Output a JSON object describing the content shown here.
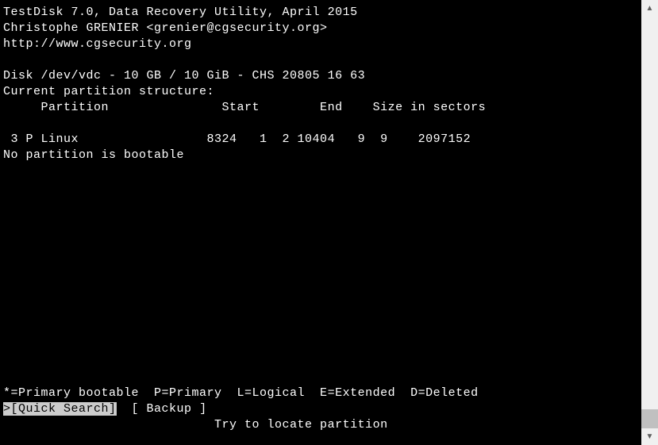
{
  "header": {
    "line1": "TestDisk 7.0, Data Recovery Utility, April 2015",
    "line2": "Christophe GRENIER <grenier@cgsecurity.org>",
    "line3": "http://www.cgsecurity.org"
  },
  "disk_info": "Disk /dev/vdc - 10 GB / 10 GiB - CHS 20805 16 63",
  "structure_label": "Current partition structure:",
  "columns_header": "     Partition               Start        End    Size in sectors",
  "partition_row": " 3 P Linux                 8324   1  2 10404   9  9    2097152",
  "bootable_warning": "No partition is bootable",
  "legend": "*=Primary bootable  P=Primary  L=Logical  E=Extended  D=Deleted",
  "menu": {
    "prefix": ">",
    "selected": "[Quick Search]",
    "rest": "  [ Backup ]"
  },
  "hint": "                            Try to locate partition"
}
